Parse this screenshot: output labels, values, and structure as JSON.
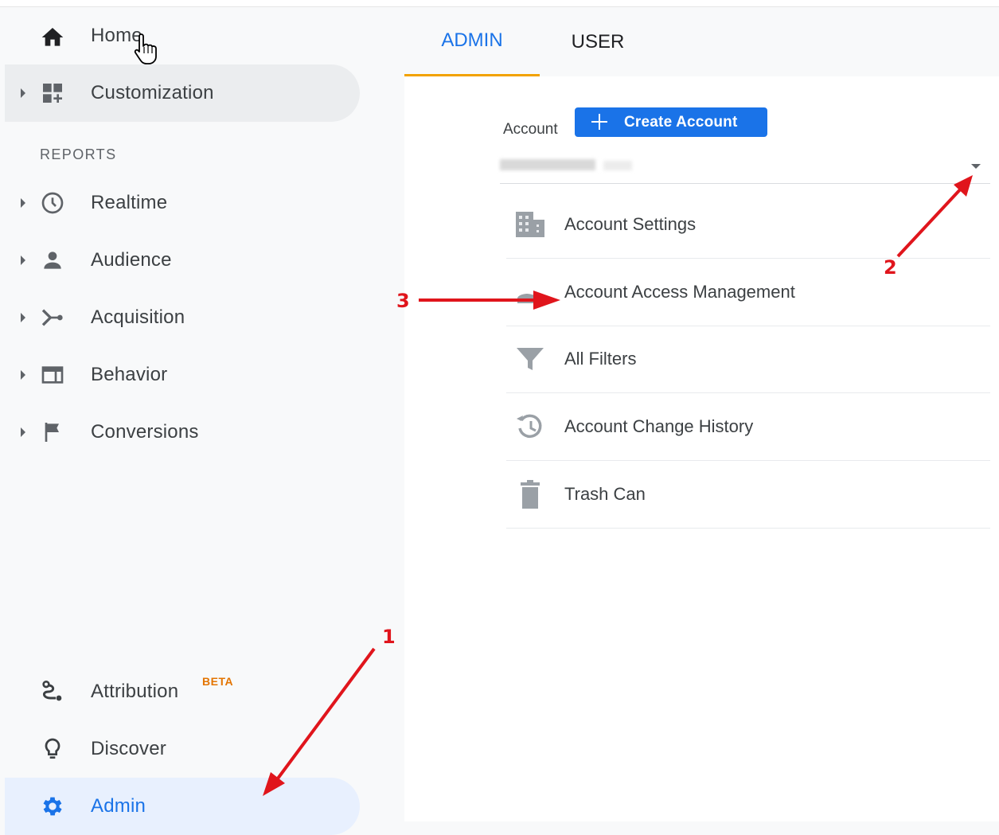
{
  "sidebar": {
    "home": {
      "label": "Home",
      "icon": "home-icon"
    },
    "customization": {
      "label": "Customization",
      "icon": "dashboard-icon"
    },
    "section_title": "REPORTS",
    "items": [
      {
        "label": "Realtime",
        "icon": "clock-icon"
      },
      {
        "label": "Audience",
        "icon": "person-icon"
      },
      {
        "label": "Acquisition",
        "icon": "acquisition-icon"
      },
      {
        "label": "Behavior",
        "icon": "window-icon"
      },
      {
        "label": "Conversions",
        "icon": "flag-icon"
      }
    ],
    "attribution": {
      "label": "Attribution",
      "badge": "BETA",
      "icon": "attribution-icon"
    },
    "discover": {
      "label": "Discover",
      "icon": "lightbulb-icon"
    },
    "admin": {
      "label": "Admin",
      "icon": "gear-icon"
    }
  },
  "tabs": {
    "admin": "ADMIN",
    "user": "USER",
    "active": "ADMIN"
  },
  "account": {
    "label": "Account",
    "create_button": "Create Account"
  },
  "menu": [
    {
      "label": "Account Settings",
      "icon": "building-icon"
    },
    {
      "label": "Account Access Management",
      "icon": "people-icon"
    },
    {
      "label": "All Filters",
      "icon": "filter-icon"
    },
    {
      "label": "Account Change History",
      "icon": "history-icon"
    },
    {
      "label": "Trash Can",
      "icon": "trash-icon"
    }
  ],
  "annotations": [
    "1",
    "2",
    "3"
  ],
  "colors": {
    "accent": "#1a73e8",
    "tab_underline": "#f2a200",
    "annotation": "#e0151c",
    "beta": "#e37400"
  }
}
